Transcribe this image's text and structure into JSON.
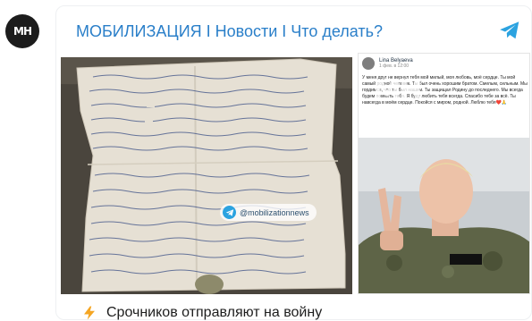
{
  "channel": {
    "avatar_initials": "МН",
    "title": "МОБИЛИЗАЦИЯ I Новости I Что делать?",
    "accent_color": "#2a7fc9",
    "share_icon": "telegram-paper-plane-icon"
  },
  "images": {
    "letter_watermark": "@mobilizationnews",
    "letter_description": "handwritten letter",
    "post": {
      "author": "Lina Belyaeva",
      "date": "1 фев. в 12:00",
      "text": "У меня друг не вернул тебя мой милый, моя любовь, моё сердце. Ты мой самый родной человек. Ты был очень хорошим братом. Смелым, сильным. Мы гордимся, что ты был нашим. Ты защищал Родину до последнего. Мы всегда будем помнить тебя. Я буду любить тебя всегда. Спасибо тебе за всё. Ты навсегда в моём сердце. Покойся с миром, родной. Люблю тебя❤️🙏",
      "mark": "МН"
    }
  },
  "caption": {
    "icon": "lightning-icon",
    "text": "Срочников отправляют на войну"
  }
}
